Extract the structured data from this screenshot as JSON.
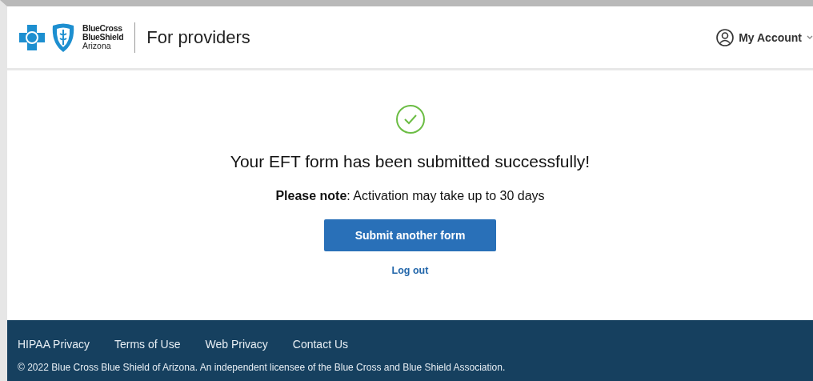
{
  "header": {
    "brand_lines": [
      "BlueCross",
      "BlueShield",
      "Arizona"
    ],
    "portal_title": "For providers",
    "account": {
      "label": "My Account"
    }
  },
  "confirmation": {
    "heading": "Your EFT form has been submitted successfully!",
    "note": "**Please note**: Activation may take up to 30 days",
    "primary_button": "Submit another form",
    "link": "Log out"
  },
  "footer": {
    "links": [
      "HIPAA Privacy",
      "Terms of Use",
      "Web Privacy",
      "Contact Us"
    ],
    "copyright": "© 2022 Blue Cross Blue Shield of Arizona. An independent licensee of the Blue Cross and Blue Shield Association."
  }
}
